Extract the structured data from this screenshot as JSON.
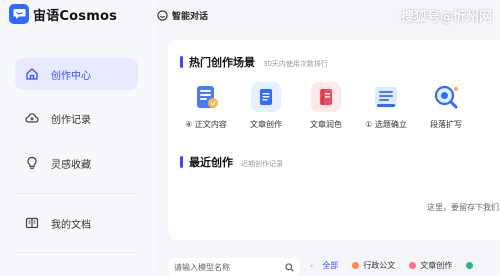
{
  "app": {
    "title": "宙语Cosmos"
  },
  "topbar": {
    "chat_label": "智能对话",
    "watermark": "搜狐号@忻州网"
  },
  "sidebar": {
    "items": [
      {
        "label": "创作中心",
        "icon": "home-icon",
        "active": true
      },
      {
        "label": "创作记录",
        "icon": "cloud-icon",
        "active": false
      },
      {
        "label": "灵感收藏",
        "icon": "lightbulb-icon",
        "active": false
      },
      {
        "label": "我的文档",
        "icon": "book-icon",
        "active": false
      }
    ]
  },
  "hot_scenes": {
    "title": "热门创作场景",
    "subtitle": "30天内使用次数排行",
    "items": [
      {
        "label": "④ 正文内容",
        "icon": "document-list-icon"
      },
      {
        "label": "文章创作",
        "icon": "article-icon"
      },
      {
        "label": "文章润色",
        "icon": "red-book-icon"
      },
      {
        "label": "① 选题确立",
        "icon": "topic-list-icon"
      },
      {
        "label": "段落扩写",
        "icon": "magnifier-icon"
      }
    ]
  },
  "recent": {
    "title": "最近创作",
    "subtitle": "近期创作记录",
    "empty_tip": "这里，要留存下我们"
  },
  "bottom": {
    "search_placeholder": "请输入模型名称",
    "filters": [
      {
        "label": "全部",
        "active": true
      },
      {
        "label": "行政公文",
        "active": false,
        "color": "#ff8a3d"
      },
      {
        "label": "文章创作",
        "active": false,
        "color": "#ff6b8a"
      },
      {
        "label": "",
        "active": false,
        "color": "#2bb673"
      }
    ]
  },
  "colors": {
    "accent": "#3b49ff",
    "brand": "#2f6bff"
  }
}
